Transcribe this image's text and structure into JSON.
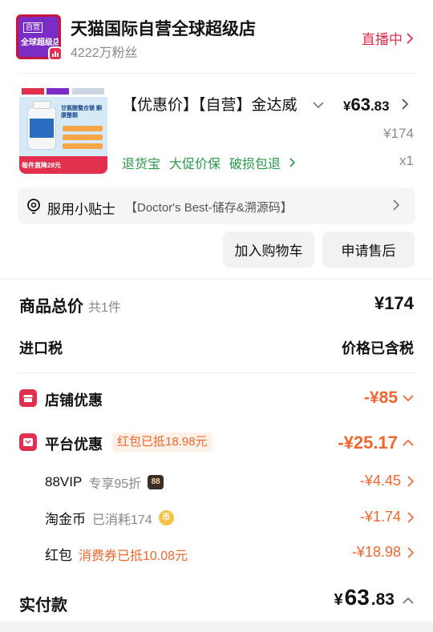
{
  "store": {
    "logo_tag": "自营",
    "logo_text": "全球超级店",
    "name": "天猫国际自营全球超级店",
    "fans": "4222万粉丝",
    "live_label": "直播中"
  },
  "product": {
    "thumb_title": "甘氨酸螯合镁 酮康整颗",
    "thumb_promo": "每件直降28元",
    "title": "【优惠价】【自营】金达威",
    "price_currency": "¥",
    "price_int": "63",
    "price_dec": ".83",
    "original_price": "¥174",
    "quantity": "x1",
    "services": [
      "退货宝",
      "大促价保",
      "破损包退"
    ]
  },
  "tips": {
    "label": "服用小贴士",
    "text": "【Doctor's Best-储存&溯源码】"
  },
  "actions": {
    "add_cart": "加入购物车",
    "after_sale": "申请售后"
  },
  "summary": {
    "total_label": "商品总价",
    "total_count": "共1件",
    "total_value": "¥174",
    "tax_label": "进口税",
    "tax_value": "价格已含税"
  },
  "store_discount": {
    "label": "店铺优惠",
    "value": "-¥85"
  },
  "platform_discount": {
    "label": "平台优惠",
    "tag": "红包已抵18.98元",
    "value": "-¥25.17",
    "items": [
      {
        "label": "88VIP",
        "note": "专享95折",
        "badge": "88",
        "value": "-¥4.45"
      },
      {
        "label": "淘金币",
        "note": "已消耗174",
        "badge": "币",
        "value": "-¥1.74"
      },
      {
        "label": "红包",
        "note": "消费券已抵10.08元",
        "badge": "",
        "value": "-¥18.98"
      }
    ]
  },
  "payment": {
    "label": "实付款",
    "currency": "¥",
    "int": "63",
    "dec": ".83"
  },
  "colors": {
    "brand_red": "#e0304e",
    "discount_orange": "#f0662e",
    "service_green": "#2a9a4a"
  }
}
